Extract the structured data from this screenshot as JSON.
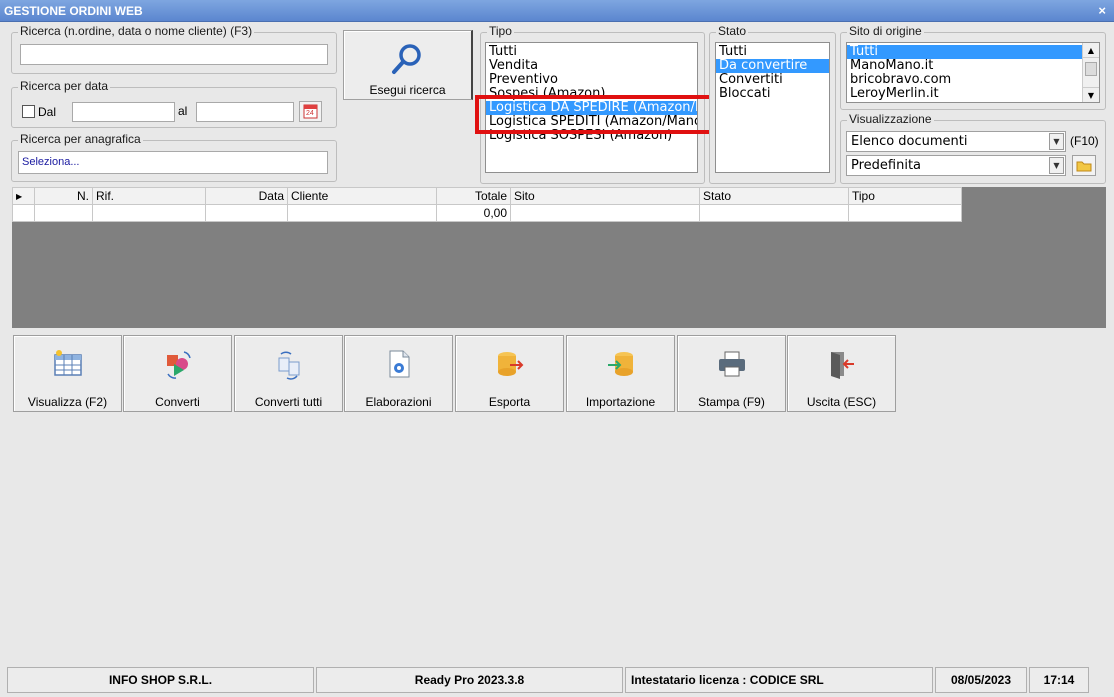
{
  "window": {
    "title": "GESTIONE ORDINI WEB",
    "close_glyph": "×"
  },
  "search": {
    "text_label": "Ricerca (n.ordine, data o nome cliente) (F3)",
    "text_value": "",
    "date_label": "Ricerca per data",
    "dal_label": "Dal",
    "al_label": "al",
    "calendar_day": "24",
    "anagrafica_label": "Ricerca per anagrafica",
    "anagrafica_value": "Seleziona...",
    "run_button": "Esegui ricerca"
  },
  "tipo": {
    "label": "Tipo",
    "items": [
      "Tutti",
      "Vendita",
      "Preventivo",
      "Sospesi (Amazon)",
      "Logistica DA SPEDIRE (Amazon/M",
      "Logistica SPEDITI (Amazon/Mano",
      "Logistica SOSPESI (Amazon)"
    ],
    "selected_index": 4
  },
  "stato": {
    "label": "Stato",
    "items": [
      "Tutti",
      "Da convertire",
      "Convertiti",
      "Bloccati"
    ],
    "selected_index": 1
  },
  "sito": {
    "label": "Sito di origine",
    "items": [
      "Tutti",
      "ManoMano.it",
      "bricobravo.com",
      "LeroyMerlin.it"
    ],
    "selected_index": 0
  },
  "visualizzazione": {
    "label": "Visualizzazione",
    "combo1": "Elenco documenti",
    "shortcut": "(F10)",
    "combo2": "Predefinita"
  },
  "grid": {
    "columns": [
      "N.",
      "Rif.",
      "Data",
      "Cliente",
      "Totale",
      "Sito",
      "Stato",
      "Tipo"
    ],
    "rows": [
      [
        "",
        "",
        "",
        "",
        "0,00",
        "",
        "",
        ""
      ]
    ]
  },
  "toolbar": {
    "visualizza": "Visualizza (F2)",
    "converti": "Converti",
    "converti_tutti": "Converti tutti",
    "elaborazioni": "Elaborazioni",
    "esporta": "Esporta",
    "importazione": "Importazione",
    "stampa": "Stampa (F9)",
    "uscita": "Uscita (ESC)"
  },
  "status": {
    "company": "INFO SHOP S.R.L.",
    "version": "Ready Pro 2023.3.8",
    "license": "Intestatario licenza : CODICE SRL",
    "date": "08/05/2023",
    "time": "17:14"
  },
  "colors": {
    "selection": "#3399ff",
    "highlight_box": "#e01010",
    "title_bar": "#5b86cf"
  }
}
